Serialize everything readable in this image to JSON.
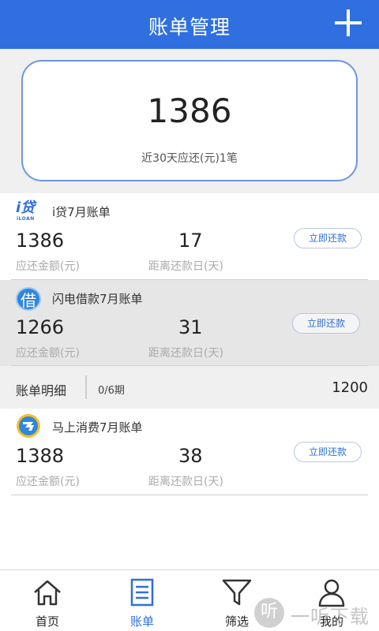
{
  "header": {
    "title": "账单管理"
  },
  "summary": {
    "amount": "1386",
    "desc": "近30天应还(元)1笔"
  },
  "bills": [
    {
      "logo_text": "i贷",
      "logo_sub": "iLOAN",
      "name": "i贷7月账单",
      "amount": "1386",
      "days": "17",
      "amount_label": "应还金额(元)",
      "days_label": "距离还款日(天)",
      "button": "立即还款"
    },
    {
      "logo_text": "借",
      "name": "闪电借款7月账单",
      "amount": "1266",
      "days": "31",
      "amount_label": "应还金额(元)",
      "days_label": "距离还款日(天)",
      "button": "立即还款"
    },
    {
      "logo_text": "马",
      "name": "马上消费7月账单",
      "amount": "1388",
      "days": "38",
      "amount_label": "应还金额(元)",
      "days_label": "距离还款日(天)",
      "button": "立即还款"
    }
  ],
  "detail": {
    "label": "账单明细",
    "period": "0/6期",
    "amount": "1200"
  },
  "tabs": [
    {
      "label": "首页",
      "icon": "home-icon"
    },
    {
      "label": "账单",
      "icon": "bill-icon"
    },
    {
      "label": "筛选",
      "icon": "filter-icon"
    },
    {
      "label": "我的",
      "icon": "user-icon"
    }
  ],
  "watermark": {
    "glyph": "听",
    "text": "一听下载"
  },
  "colors": {
    "accent": "#2f6fe0",
    "card_border": "#6e95e6"
  }
}
